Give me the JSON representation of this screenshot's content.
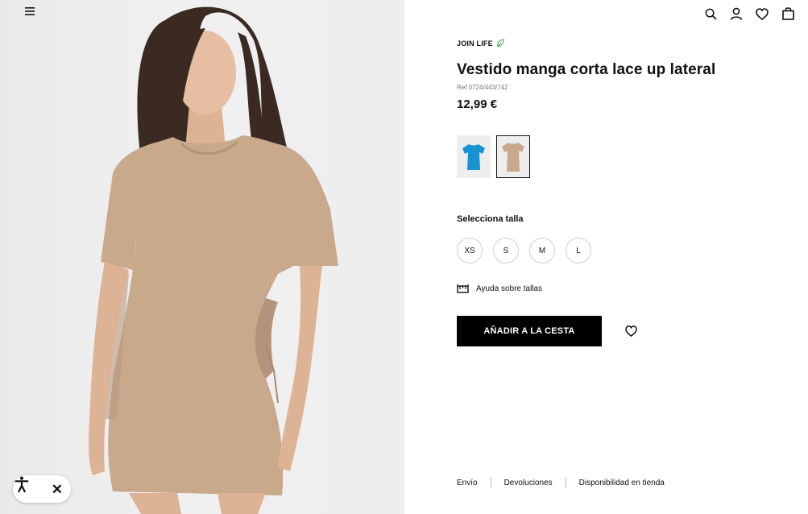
{
  "header": {
    "icons": [
      "menu-icon",
      "search-icon",
      "user-icon",
      "heart-icon",
      "bag-icon"
    ]
  },
  "product": {
    "brand_label": "JOIN LIFE",
    "title": "Vestido manga corta lace up lateral",
    "ref": "Ref 0724/443/742",
    "price": "12,99 €",
    "colors": [
      {
        "name": "azul",
        "hex": "#1593d2",
        "selected": false
      },
      {
        "name": "beige",
        "hex": "#c8a98c",
        "selected": true
      }
    ],
    "size_label": "Selecciona talla",
    "sizes": [
      "XS",
      "S",
      "M",
      "L"
    ],
    "size_help": "Ayuda sobre tallas",
    "add_to_cart": "AÑADIR A LA CESTA"
  },
  "footer": {
    "links": [
      "Envío",
      "Devoluciones",
      "Disponibilidad en tienda"
    ]
  },
  "colors": {
    "accent": "#000000",
    "leaf": "#3fae49",
    "background": "#ffffff"
  }
}
